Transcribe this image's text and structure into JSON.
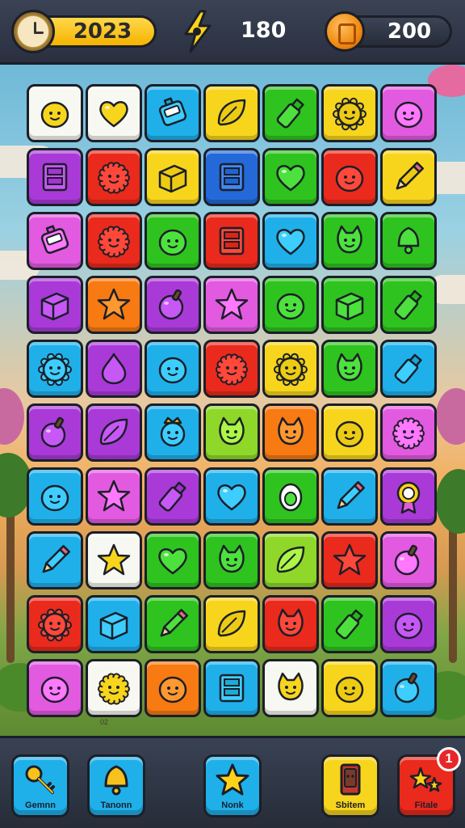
{
  "hud": {
    "year": "2023",
    "score": "180",
    "coins": "200",
    "icons": [
      "clock-icon",
      "lightning-icon",
      "coin-icon"
    ]
  },
  "colors": {
    "yellow": "#f7d51d",
    "blue": "#1fb0ea",
    "green": "#2fc31f",
    "red": "#ea2a1c",
    "purple": "#a93ad8",
    "magenta": "#e25ae0",
    "orange": "#f77a12",
    "white": "#f8f8f2",
    "lime": "#8fd82a",
    "navy": "#2469d8"
  },
  "board": {
    "rows": [
      [
        [
          "white",
          "blob-face"
        ],
        [
          "white",
          "heart"
        ],
        [
          "blue",
          "robot"
        ],
        [
          "yellow",
          "leaf"
        ],
        [
          "green",
          "bottle"
        ],
        [
          "yellow",
          "sun-face"
        ],
        [
          "magenta",
          "blob-face"
        ]
      ],
      [
        [
          "purple",
          "book"
        ],
        [
          "red",
          "fuzzy-face"
        ],
        [
          "yellow",
          "box"
        ],
        [
          "navy",
          "book"
        ],
        [
          "green",
          "heart"
        ],
        [
          "red",
          "blob-face"
        ],
        [
          "yellow",
          "pencil"
        ]
      ],
      [
        [
          "magenta",
          "robot"
        ],
        [
          "red",
          "fuzzy-face"
        ],
        [
          "green",
          "blob-face"
        ],
        [
          "red",
          "book"
        ],
        [
          "blue",
          "heart"
        ],
        [
          "green",
          "cat-face"
        ],
        [
          "green",
          "bell"
        ]
      ],
      [
        [
          "purple",
          "box"
        ],
        [
          "orange",
          "star"
        ],
        [
          "purple",
          "apple"
        ],
        [
          "magenta",
          "star"
        ],
        [
          "green",
          "blob-face"
        ],
        [
          "green",
          "box"
        ],
        [
          "green",
          "bottle"
        ]
      ],
      [
        [
          "blue",
          "sun-face"
        ],
        [
          "purple",
          "drop"
        ],
        [
          "blue",
          "blob-face"
        ],
        [
          "red",
          "fuzzy-face"
        ],
        [
          "yellow",
          "sun-face"
        ],
        [
          "green",
          "cat-face"
        ],
        [
          "blue",
          "bottle"
        ]
      ],
      [
        [
          "purple",
          "apple"
        ],
        [
          "purple",
          "leaf"
        ],
        [
          "blue",
          "crown-face"
        ],
        [
          "lime",
          "cat-face"
        ],
        [
          "orange",
          "cat-face"
        ],
        [
          "yellow",
          "blob-face"
        ],
        [
          "magenta",
          "fuzzy-face"
        ]
      ],
      [
        [
          "blue",
          "blob-face"
        ],
        [
          "magenta",
          "star"
        ],
        [
          "purple",
          "bottle"
        ],
        [
          "blue",
          "heart"
        ],
        [
          "green",
          "egg"
        ],
        [
          "blue",
          "pencil"
        ],
        [
          "purple",
          "medal"
        ]
      ],
      [
        [
          "blue",
          "pencil"
        ],
        [
          "white",
          "star"
        ],
        [
          "green",
          "heart"
        ],
        [
          "green",
          "cat-face"
        ],
        [
          "lime",
          "leaf"
        ],
        [
          "red",
          "star"
        ],
        [
          "magenta",
          "apple"
        ]
      ],
      [
        [
          "red",
          "sun-face"
        ],
        [
          "blue",
          "box"
        ],
        [
          "green",
          "pencil"
        ],
        [
          "yellow",
          "leaf"
        ],
        [
          "red",
          "cat-face"
        ],
        [
          "green",
          "bottle"
        ],
        [
          "purple",
          "blob-face"
        ]
      ],
      [
        [
          "magenta",
          "blob-face"
        ],
        [
          "white",
          "fuzzy-face"
        ],
        [
          "orange",
          "blob-face"
        ],
        [
          "blue",
          "book"
        ],
        [
          "white",
          "cat-face"
        ],
        [
          "yellow",
          "blob-face"
        ],
        [
          "blue",
          "apple"
        ]
      ]
    ]
  },
  "bottom_bar": {
    "buttons": [
      {
        "label": "Gemnn",
        "color": "#1fb0ea",
        "icon": "key-icon"
      },
      {
        "label": "Tanonn",
        "color": "#1fb0ea",
        "icon": "bell-icon"
      },
      {
        "label": "Nonk",
        "color": "#1fb0ea",
        "icon": "star-icon"
      },
      {
        "label": "Sbitem",
        "color": "#f7d51d",
        "icon": "card-icon"
      },
      {
        "label": "Fitale",
        "color": "#ea2a1c",
        "icon": "sparkle-icon"
      }
    ],
    "badge_count": "1"
  },
  "board_footer_text": "02"
}
